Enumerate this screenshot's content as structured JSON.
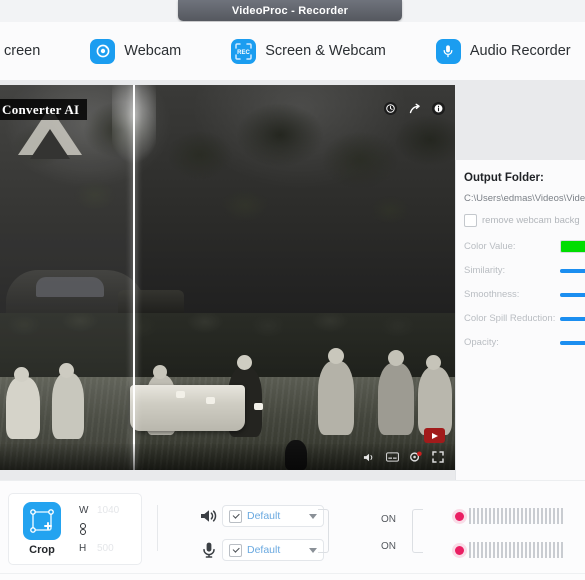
{
  "window": {
    "title": "VideoProc - Recorder"
  },
  "modes": {
    "items": [
      {
        "label": "creen",
        "icon": "screen-icon",
        "clipped": true
      },
      {
        "label": "Webcam",
        "icon": "webcam-icon",
        "clipped": false
      },
      {
        "label": "Screen & Webcam",
        "icon": "rec-icon",
        "clipped": false
      },
      {
        "label": "Audio Recorder",
        "icon": "microphone-icon",
        "clipped": false
      }
    ]
  },
  "preview": {
    "overlay_title": "Converter AI",
    "icons": [
      "clock-icon",
      "share-icon",
      "info-icon"
    ],
    "player_controls": [
      "volume-icon",
      "subtitles-icon",
      "settings-icon",
      "fullscreen-icon"
    ],
    "watermark": "youtube-logo"
  },
  "settings": {
    "output_folder_label": "Output Folder:",
    "output_folder_path": "C:\\Users\\edmas\\Videos\\VideoP",
    "remove_bg_label": "remove webcam backg",
    "remove_bg_checked": false,
    "rows": [
      {
        "label": "Color Value:",
        "type": "swatch",
        "color": "#00dd00",
        "value": 100
      },
      {
        "label": "Similarity:",
        "type": "slider",
        "value": 62
      },
      {
        "label": "Smoothness:",
        "type": "slider",
        "value": 62
      },
      {
        "label": "Color Spill Reduction:",
        "type": "slider",
        "value": 100
      },
      {
        "label": "Opacity:",
        "type": "slider",
        "value": 100
      }
    ]
  },
  "bottom": {
    "crop_label": "Crop",
    "crop_icon": "crop-icon",
    "width_key": "W",
    "width_value": "1040",
    "height_key": "H",
    "height_value": "500",
    "lock_icon": "link-lock-icon",
    "audio": [
      {
        "icon": "speaker-icon",
        "device": "Default",
        "checked": true,
        "state": "ON",
        "meter_segments": 24
      },
      {
        "icon": "microphone-icon",
        "device": "Default",
        "checked": true,
        "state": "ON",
        "meter_segments": 24
      }
    ]
  },
  "colors": {
    "accent": "#1b9df0",
    "green_key": "#00dd00",
    "rec_red": "#ea1f63",
    "titlebar": "#55585f"
  }
}
